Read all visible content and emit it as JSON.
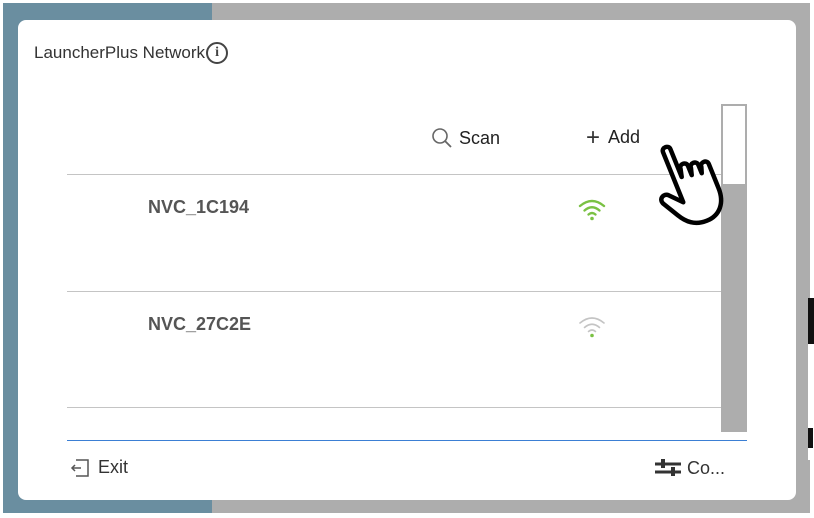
{
  "dialog": {
    "title": "LauncherPlus Network",
    "info_icon": "info-icon"
  },
  "toolbar": {
    "scan_label": "Scan",
    "scan_icon": "search-icon",
    "add_label": "Add",
    "add_icon": "plus-icon"
  },
  "networks": [
    {
      "name": "NVC_1C194",
      "signal_icon": "wifi-icon",
      "signal_color": "#7ac143"
    },
    {
      "name": "NVC_27C2E",
      "signal_icon": "wifi-icon",
      "signal_color": "#bdbdbd"
    }
  ],
  "footer": {
    "exit_label": "Exit",
    "exit_icon": "exit-icon",
    "config_label": "Co...",
    "config_icon": "sliders-icon"
  },
  "colors": {
    "accent_line": "#3b7fd4",
    "signal_active": "#7ac143"
  },
  "cursor_icon": "hand-pointer-icon"
}
